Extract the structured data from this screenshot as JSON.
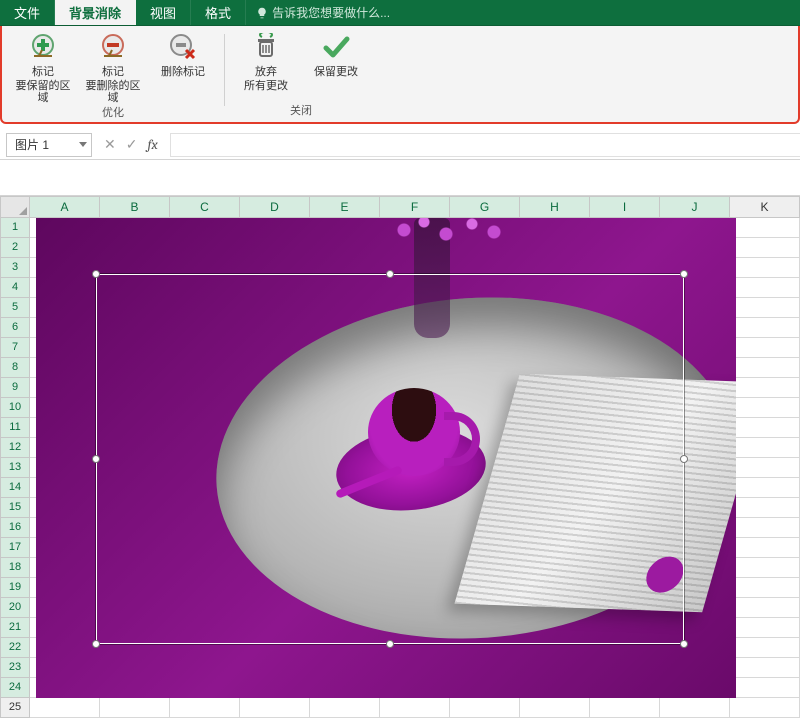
{
  "tabs": {
    "file": "文件",
    "bg_remove": "背景消除",
    "view": "视图",
    "format": "格式",
    "tell_me": "告诉我您想要做什么..."
  },
  "ribbon": {
    "mark_keep": {
      "line1": "标记",
      "line2": "要保留的区域"
    },
    "mark_remove": {
      "line1": "标记",
      "line2": "要删除的区域"
    },
    "delete_mark": "删除标记",
    "discard": {
      "line1": "放弃",
      "line2": "所有更改"
    },
    "keep_changes": "保留更改",
    "group_refine": "优化",
    "group_close": "关闭"
  },
  "namebox": "图片 1",
  "fx": {
    "cancel": "✕",
    "enter": "✓",
    "fx": "fx"
  },
  "columns": [
    "A",
    "B",
    "C",
    "D",
    "E",
    "F",
    "G",
    "H",
    "I",
    "J",
    "K"
  ],
  "rows": [
    1,
    2,
    3,
    4,
    5,
    6,
    7,
    8,
    9,
    10,
    11,
    12,
    13,
    14,
    15,
    16,
    17,
    18,
    19,
    20,
    21,
    22,
    23,
    24,
    25
  ]
}
